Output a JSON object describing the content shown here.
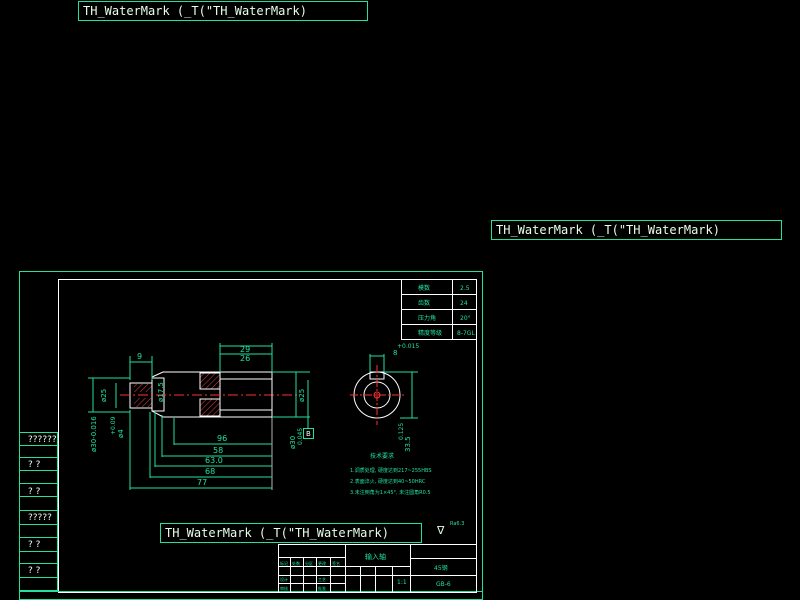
{
  "watermarks": [
    "TH_WaterMark (_T(\"TH_WaterMark)",
    "TH_WaterMark (_T(\"TH_WaterMark)",
    "TH_WaterMark (_T(\"TH_WaterMark)"
  ],
  "left_strip": [
    "??????",
    "?  ?",
    "?  ?",
    "?????",
    "?  ?",
    "?  ?"
  ],
  "param_table": [
    [
      "模数",
      "2.5"
    ],
    [
      "齿数",
      "24"
    ],
    [
      "压力角",
      "20°"
    ],
    [
      "精度等级",
      "8-7GL"
    ]
  ],
  "dimensions": {
    "d_9": "9",
    "d_29": "29",
    "d_26": "26",
    "d_96": "96",
    "d_58": "58",
    "d_63": "63.0",
    "d_68": "68",
    "d_77": "77",
    "dia_25_left": "ø25",
    "dia_17": "ø17.5",
    "dia_25_right": "ø25",
    "dia_30": "ø30",
    "dia_4": "ø4",
    "dia_30_k6": "ø30-0.016",
    "tol_4": "+0.09",
    "tol_30": "0.045",
    "datum": "B",
    "key_width": "8",
    "key_tol": "+0.015",
    "key_depth": "33.5",
    "key_depth_tol": "0.125"
  },
  "tech_req": {
    "title": "技术要求",
    "items": [
      "1.调质处理, 硬度达到217~255HBS",
      "2.表面淬火, 硬度达到40~50HRC",
      "3.未注倒角为1×45°, 未注圆角R0.5"
    ]
  },
  "surface_symbol": "∇",
  "surface_note": "Ra6.3",
  "title_block": {
    "part_name": "输入轴",
    "material": "45钢",
    "drawing_no": "GB-6",
    "scale": "1:1",
    "cells": [
      "标记",
      "处数",
      "分区",
      "更改",
      "签名",
      "设计",
      "审核",
      "工艺",
      "批准"
    ]
  }
}
